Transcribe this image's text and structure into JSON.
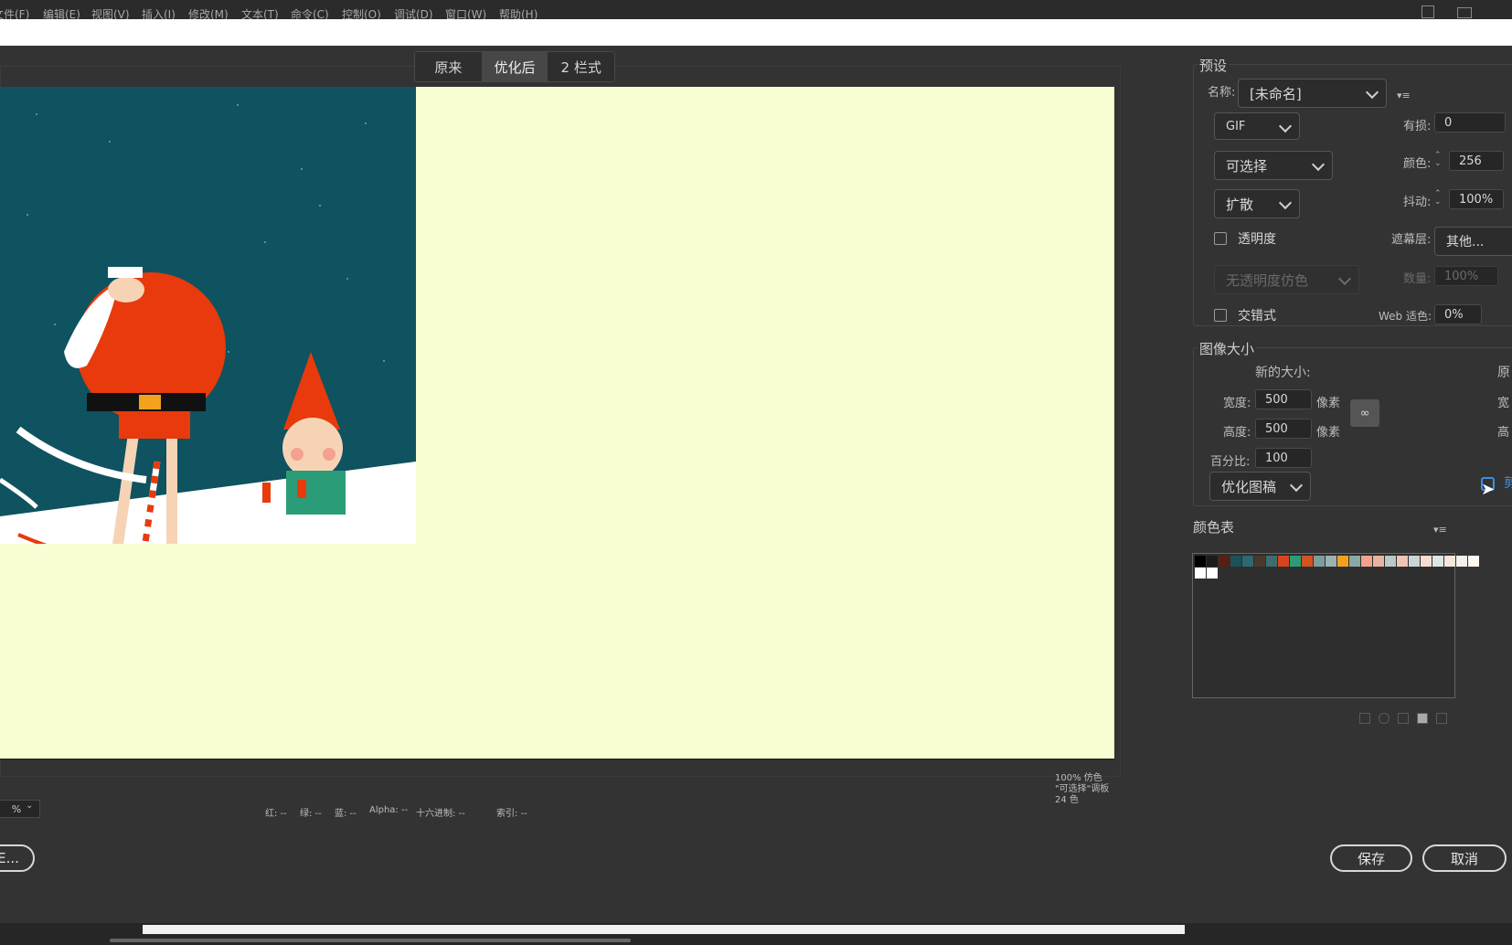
{
  "menu": [
    "文件(F)",
    "编辑(E)",
    "视图(V)",
    "插入(I)",
    "修改(M)",
    "文本(T)",
    "命令(C)",
    "控制(O)",
    "调试(D)",
    "窗口(W)",
    "帮助(H)"
  ],
  "tabs": [
    "原来",
    "优化后",
    "2 栏式"
  ],
  "preset": {
    "section": "预设",
    "name_label": "名称:",
    "name_value": "[未命名]",
    "format": "GIF",
    "palette": "可选择",
    "dither_type": "扩散",
    "lossy_label": "有损:",
    "lossy_value": "0",
    "colors_label": "颜色:",
    "colors_value": "256",
    "dither_label": "抖动:",
    "dither_value": "100%",
    "transparency_label": "透明度",
    "matte_label": "遮幕层:",
    "matte_value": "其他...",
    "transparency_dither": "无透明度仿色",
    "amount_label": "数量:",
    "amount_value": "100%",
    "interlaced_label": "交错式",
    "web_snap_label": "Web 适色:",
    "web_snap_value": "0%"
  },
  "image_size": {
    "section": "图像大小",
    "new_size_label": "新的大小:",
    "original_label": "原",
    "width_label": "宽度:",
    "width_value": "500",
    "height_label": "高度:",
    "height_value": "500",
    "unit": "像素",
    "percent_label": "百分比:",
    "percent_value": "100",
    "quality": "优化图稿",
    "orig_width_short": "宽",
    "orig_height_short": "高",
    "clip_short": "剪"
  },
  "color_table": {
    "section": "颜色表",
    "colors": [
      "#000000",
      "#1b1b1b",
      "#5a1f14",
      "#1f4f5a",
      "#2d6a70",
      "#4a3a2c",
      "#3d6e6e",
      "#d9431e",
      "#2a9d78",
      "#d4531f",
      "#7d9c9a",
      "#9fb1af",
      "#f0a21e",
      "#8aa9a6",
      "#f2a28f",
      "#e8b4a2",
      "#b8c9c7",
      "#f0c5b5",
      "#c9d6d4",
      "#f7dccf",
      "#dce6e4",
      "#f4e6da",
      "#f2f0ec",
      "#fff8ef",
      "#ffffff",
      "#ffffff"
    ]
  },
  "status": {
    "red": "红: --",
    "green": "绿: --",
    "blue": "蓝: --",
    "alpha": "Alpha: --",
    "hex": "十六进制: --",
    "index": "索引: --",
    "zoom": "%",
    "info_line1": "100% 仿色",
    "info_line2": "\"可选择\"调板",
    "info_line3": "24 色"
  },
  "buttons": {
    "left_partial": "E...",
    "save": "保存",
    "cancel": "取消"
  }
}
